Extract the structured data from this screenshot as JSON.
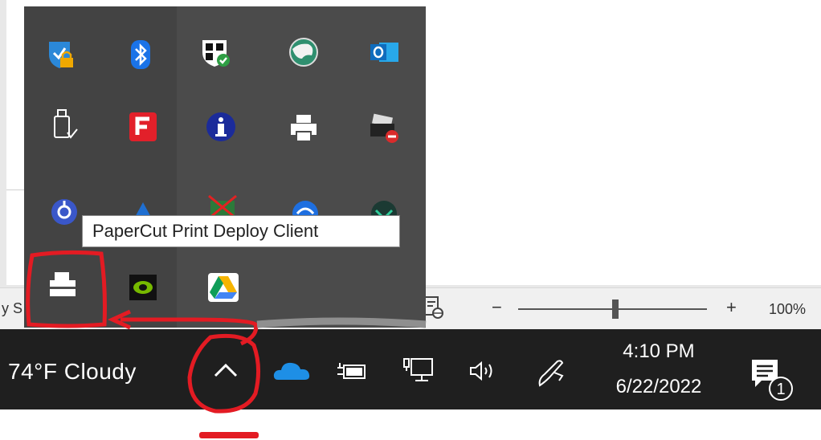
{
  "app_status": {
    "left_fragment": "y S",
    "zoom_minus": "−",
    "zoom_plus": "+",
    "zoom_level": "100%"
  },
  "taskbar": {
    "weather": "74°F  Cloudy",
    "clock_time": "4:10 PM",
    "clock_date": "6/22/2022",
    "notification_count": "1"
  },
  "tray": {
    "icons": [
      "windows-security-lock-icon",
      "bluetooth-icon",
      "defender-shield-icon",
      "browser-globe-icon",
      "outlook-icon",
      "usb-eject-icon",
      "foxit-reader-icon",
      "info-icon",
      "printer-icon",
      "printer-error-icon",
      "deploy-client-icon",
      "app-icon",
      "mail-blocked-icon",
      "wifi-app-icon",
      "app-icon-2",
      "papercut-icon",
      "nvidia-icon",
      "google-drive-icon"
    ]
  },
  "tooltip": {
    "text": "PaperCut Print Deploy Client"
  },
  "colors": {
    "annotation": "#e31b23",
    "taskbar": "#1f1f1f",
    "tray": "#4b4b4b",
    "onedrive": "#1e90ff"
  }
}
